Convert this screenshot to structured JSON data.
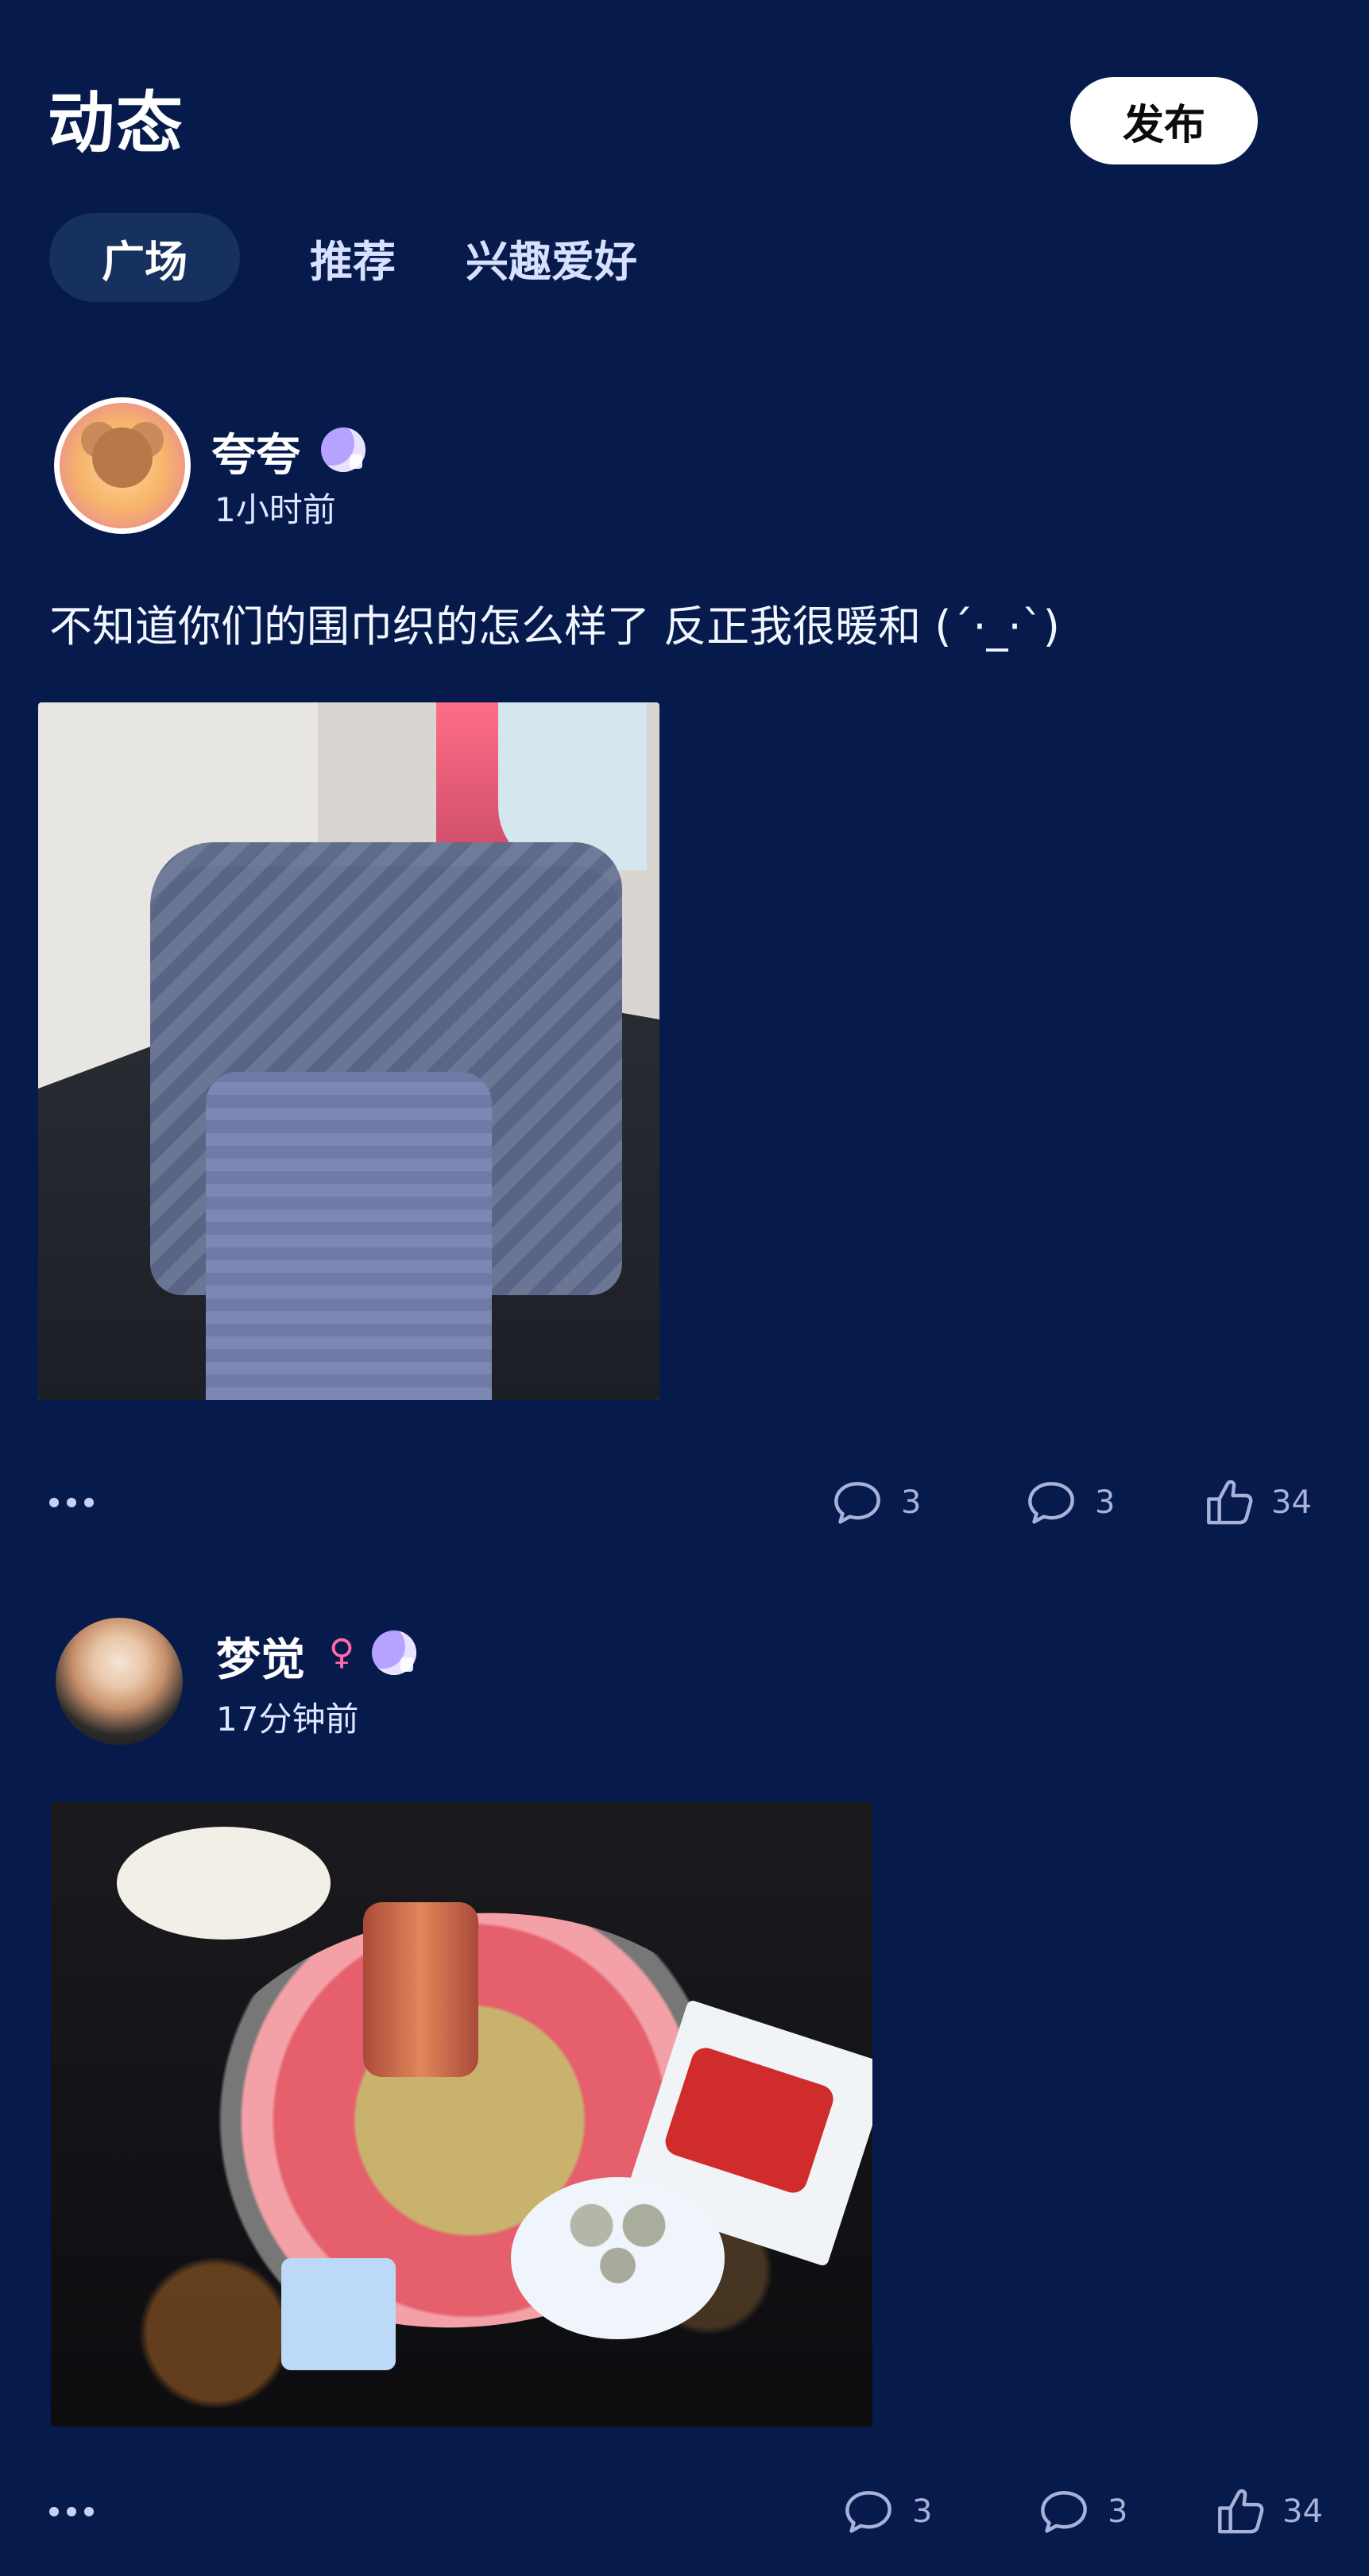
{
  "header": {
    "title": "动态",
    "publish_label": "发布"
  },
  "tabs": [
    {
      "label": "广场",
      "active": true
    },
    {
      "label": "推荐",
      "active": false
    },
    {
      "label": "兴趣爱好",
      "active": false
    }
  ],
  "posts": [
    {
      "username": "夸夸",
      "time": "1小时前",
      "badge_icon": "moon-badge-icon",
      "text": "不知道你们的围巾织的怎么样了 反正我很暖和 (´·_·`)",
      "actions": {
        "comment_count": "3",
        "comment2_count": "3",
        "like_count": "34"
      }
    },
    {
      "username": "梦觉",
      "time": "17分钟前",
      "gender_icon": "female-symbol-icon",
      "badge_icon": "moon-badge-icon",
      "actions": {
        "comment_count": "3",
        "comment2_count": "3",
        "like_count": "34"
      }
    }
  ],
  "colors": {
    "background": "#061a4c",
    "tab_active_bg": "#16305f",
    "publish_button_bg": "#ffffff",
    "muted_text": "#a8b2d8"
  }
}
